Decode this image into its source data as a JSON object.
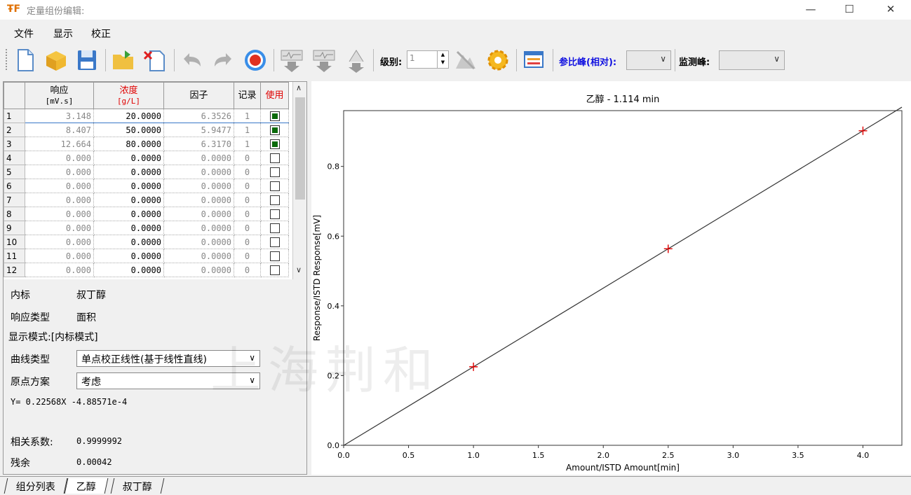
{
  "window": {
    "title": "定量组份编辑:",
    "minimize": "—",
    "maximize": "☐",
    "close": "✕"
  },
  "menu": [
    "文件",
    "显示",
    "校正"
  ],
  "toolbar": {
    "level_label": "级别:",
    "level_value": "1",
    "ref_peak_label": "参比峰(相对):",
    "monitor_peak_label": "监测峰:"
  },
  "table": {
    "headers": [
      {
        "main": "响应",
        "unit": "[mV.s]",
        "color": "#000000"
      },
      {
        "main": "浓度",
        "unit": "[g/L]",
        "color": "#e00000"
      },
      {
        "main": "因子",
        "unit": "",
        "color": "#000000"
      },
      {
        "main": "记录",
        "unit": "",
        "color": "#000000"
      },
      {
        "main": "使用",
        "unit": "",
        "color": "#e00000"
      }
    ],
    "rows": [
      {
        "n": "1",
        "resp": "3.148",
        "conc": "20.0000",
        "factor": "6.3526",
        "rec": "1",
        "use": true
      },
      {
        "n": "2",
        "resp": "8.407",
        "conc": "50.0000",
        "factor": "5.9477",
        "rec": "1",
        "use": true
      },
      {
        "n": "3",
        "resp": "12.664",
        "conc": "80.0000",
        "factor": "6.3170",
        "rec": "1",
        "use": true
      },
      {
        "n": "4",
        "resp": "0.000",
        "conc": "0.0000",
        "factor": "0.0000",
        "rec": "0",
        "use": false
      },
      {
        "n": "5",
        "resp": "0.000",
        "conc": "0.0000",
        "factor": "0.0000",
        "rec": "0",
        "use": false
      },
      {
        "n": "6",
        "resp": "0.000",
        "conc": "0.0000",
        "factor": "0.0000",
        "rec": "0",
        "use": false
      },
      {
        "n": "7",
        "resp": "0.000",
        "conc": "0.0000",
        "factor": "0.0000",
        "rec": "0",
        "use": false
      },
      {
        "n": "8",
        "resp": "0.000",
        "conc": "0.0000",
        "factor": "0.0000",
        "rec": "0",
        "use": false
      },
      {
        "n": "9",
        "resp": "0.000",
        "conc": "0.0000",
        "factor": "0.0000",
        "rec": "0",
        "use": false
      },
      {
        "n": "10",
        "resp": "0.000",
        "conc": "0.0000",
        "factor": "0.0000",
        "rec": "0",
        "use": false
      },
      {
        "n": "11",
        "resp": "0.000",
        "conc": "0.0000",
        "factor": "0.0000",
        "rec": "0",
        "use": false
      },
      {
        "n": "12",
        "resp": "0.000",
        "conc": "0.0000",
        "factor": "0.0000",
        "rec": "0",
        "use": false
      }
    ]
  },
  "props": {
    "istd_label": "内标",
    "istd_value": "叔丁醇",
    "resp_type_label": "响应类型",
    "resp_type_value": "面积",
    "display_mode": "显示模式:[内标模式]",
    "curve_type_label": "曲线类型",
    "curve_type_value": "单点校正线性(基于线性直线)",
    "origin_label": "原点方案",
    "origin_value": "考虑",
    "equation": "Y= 0.22568X -4.88571e-4",
    "corr_label": "相关系数:",
    "corr_value": "0.9999992",
    "residual_label": "残余",
    "residual_value": "0.00042"
  },
  "watermark": "上海荆和",
  "tabs": [
    "组分列表",
    "乙醇",
    "叔丁醇"
  ],
  "active_tab": 1,
  "chart_data": {
    "type": "scatter",
    "title": "乙醇 - 1.114 min",
    "xlabel": "Amount/ISTD Amount[min]",
    "ylabel": "Response/ISTD Response[mV]",
    "xlim": [
      0.0,
      4.3
    ],
    "ylim": [
      0.0,
      0.96
    ],
    "xticks": [
      "0.0",
      "0.5",
      "1.0",
      "1.5",
      "2.0",
      "2.5",
      "3.0",
      "3.5",
      "4.0"
    ],
    "yticks": [
      "0.0",
      "0.2",
      "0.4",
      "0.6",
      "0.8"
    ],
    "points": [
      {
        "x": 1.0,
        "y": 0.2252
      },
      {
        "x": 2.5,
        "y": 0.5637
      },
      {
        "x": 4.0,
        "y": 0.9022
      }
    ],
    "fit": {
      "slope": 0.22568,
      "intercept": -0.000488571
    },
    "point_color": "#e00000",
    "line_color": "#333333",
    "grid": false
  }
}
